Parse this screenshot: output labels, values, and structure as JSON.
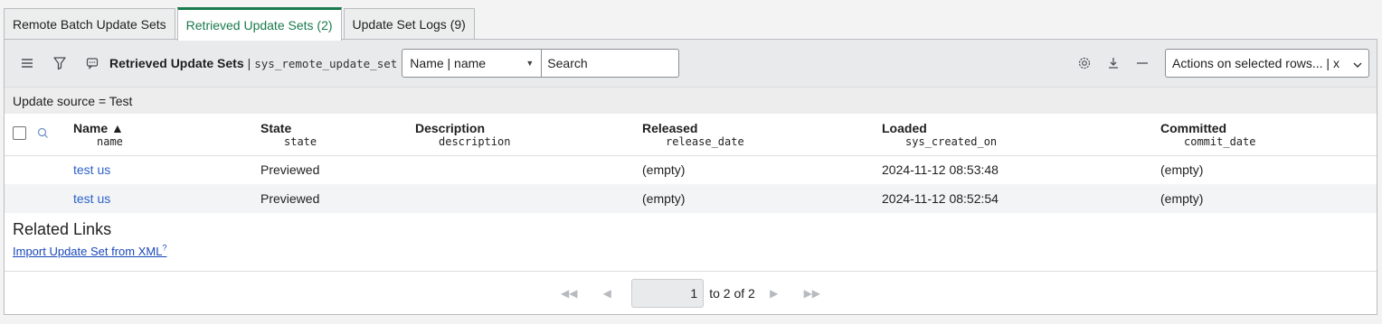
{
  "tabs": [
    {
      "label": "Remote Batch Update Sets"
    },
    {
      "label": "Retrieved Update Sets (2)"
    },
    {
      "label": "Update Set Logs (9)"
    }
  ],
  "toolbar": {
    "title": "Retrieved Update Sets",
    "separator": "|",
    "table_name": "sys_remote_update_set",
    "field_select": "Name | name",
    "search_placeholder": "Search",
    "actions_label": "Actions on selected rows... | x"
  },
  "filter": {
    "text": "Update source = Test"
  },
  "columns": [
    {
      "label": "Name ▲",
      "field": "name"
    },
    {
      "label": "State",
      "field": "state"
    },
    {
      "label": "Description",
      "field": "description"
    },
    {
      "label": "Released",
      "field": "release_date"
    },
    {
      "label": "Loaded",
      "field": "sys_created_on"
    },
    {
      "label": "Committed",
      "field": "commit_date"
    }
  ],
  "rows": [
    {
      "name": "test us",
      "state": "Previewed",
      "description": "",
      "released": "(empty)",
      "loaded": "2024-11-12 08:53:48",
      "committed": "(empty)"
    },
    {
      "name": "test us",
      "state": "Previewed",
      "description": "",
      "released": "(empty)",
      "loaded": "2024-11-12 08:52:54",
      "committed": "(empty)"
    }
  ],
  "related": {
    "title": "Related Links",
    "link": "Import Update Set from XML",
    "link_marker": "?"
  },
  "pager": {
    "current": "1",
    "total_text": "to 2 of 2"
  },
  "icons": {
    "menu": "hamburger-icon",
    "filter": "funnel-icon",
    "comments": "chat-icon",
    "settings": "gear-icon",
    "export": "download-icon",
    "collapse": "minus-icon"
  },
  "colors": {
    "accent": "#1a7a4c",
    "link": "#2d62c9"
  }
}
